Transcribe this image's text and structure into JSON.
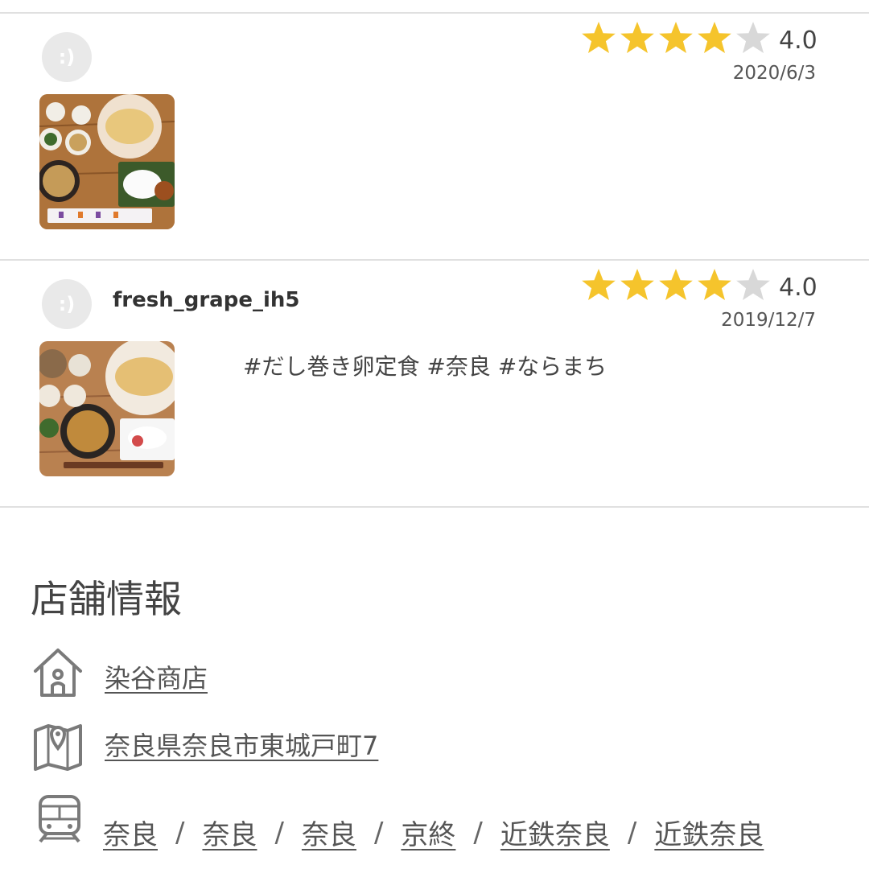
{
  "reviews": [
    {
      "avatar": ":)",
      "username": "",
      "rating": 4.0,
      "rating_text": "4.0",
      "stars_filled": 4,
      "stars_total": 5,
      "date": "2020/6/3",
      "text": ""
    },
    {
      "avatar": ":)",
      "username": "fresh_grape_ih5",
      "rating": 4.0,
      "rating_text": "4.0",
      "stars_filled": 4,
      "stars_total": 5,
      "date": "2019/12/7",
      "text": "#だし巻き卵定食 #奈良 #ならまち"
    }
  ],
  "store_info": {
    "title": "店舗情報",
    "name": "染谷商店",
    "address": "奈良県奈良市東城戸町7",
    "stations": [
      "奈良",
      "奈良",
      "奈良",
      "京終",
      "近鉄奈良",
      "近鉄奈良"
    ],
    "separator": "/"
  },
  "icons": {
    "avatar": "smiley-avatar-icon",
    "star": "star-icon",
    "store": "house-icon",
    "address": "map-pin-icon",
    "station": "train-icon"
  },
  "colors": {
    "star_filled": "#F5C42C",
    "star_empty": "#D8D8D8",
    "divider": "#E0E0E0",
    "avatar_bg": "#E9E9E9",
    "icon_gray": "#7A7A7A"
  }
}
